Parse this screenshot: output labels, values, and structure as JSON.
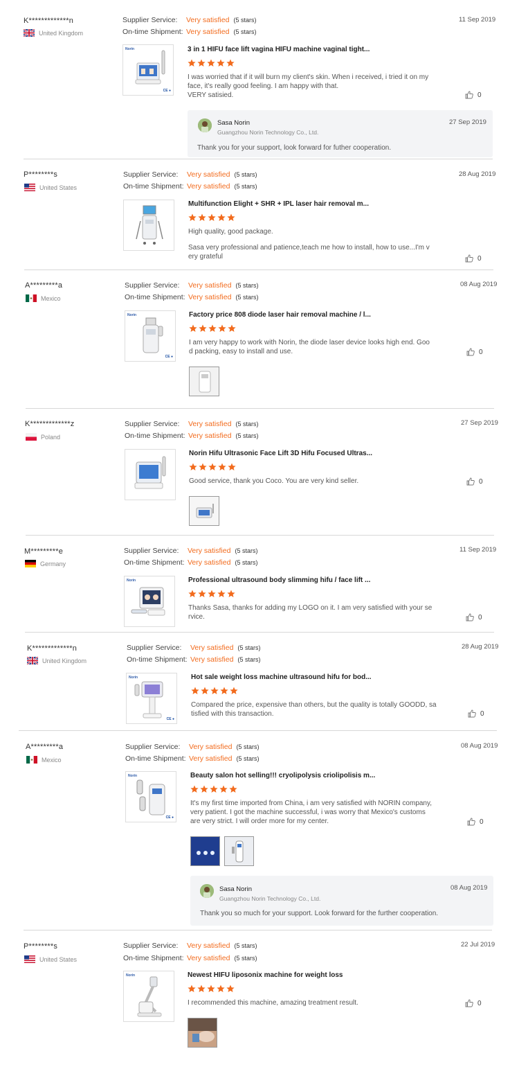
{
  "labels": {
    "supplier_service": "Supplier Service:",
    "ontime_shipment": "On-time Shipment:"
  },
  "accent_color": "#f26b1d",
  "reviews": [
    {
      "user": "K*************n",
      "country": "United Kingdom",
      "flag": "uk-flag-icon",
      "service_value": "Very satisfied",
      "service_stars": "(5 stars)",
      "shipment_value": "Very satisfied",
      "shipment_stars": "(5 stars)",
      "date": "11 Sep 2019",
      "product_title": "3 in 1 HIFU face lift vagina HIFU machine vaginal tight...",
      "rating": 5,
      "text_lines": [
        "I was worried that if it will burn my client's skin. When i received, i tried it on my",
        "face, it's really good feeling. I am happy with that.",
        "VERY satisied."
      ],
      "likes": "0",
      "reply": {
        "name": "Sasa Norin",
        "company": "Guangzhou Norin Technology Co., Ltd.",
        "date": "27 Sep 2019",
        "text": "Thank you for your support, look forward for futher cooperation."
      }
    },
    {
      "user": "P********s",
      "country": "United States",
      "flag": "us-flag-icon",
      "service_value": "Very satisfied",
      "service_stars": "(5 stars)",
      "shipment_value": "Very satisfied",
      "shipment_stars": "(5 stars)",
      "date": "28 Aug 2019",
      "product_title": "Multifunction Elight + SHR + IPL laser hair removal m...",
      "rating": 5,
      "text_lines": [
        "High quality, good package.",
        "",
        "Sasa very professional and patience,teach me how to install, how to use...I'm v",
        "ery grateful"
      ],
      "likes": "0"
    },
    {
      "user": "A*********a",
      "country": "Mexico",
      "flag": "mexico-flag-icon",
      "service_value": "Very satisfied",
      "service_stars": "(5 stars)",
      "shipment_value": "Very satisfied",
      "shipment_stars": "(5 stars)",
      "date": "08 Aug 2019",
      "product_title": "Factory price 808 diode laser hair removal machine / l...",
      "rating": 5,
      "text_lines": [
        "I am very happy to work with Norin, the diode laser device looks high end. Goo",
        "d packing, easy to install and use."
      ],
      "likes": "0"
    },
    {
      "user": "K*************z",
      "country": "Poland",
      "flag": "poland-flag-icon",
      "service_value": "Very satisfied",
      "service_stars": "(5 stars)",
      "shipment_value": "Very satisfied",
      "shipment_stars": "(5 stars)",
      "date": "27 Sep 2019",
      "product_title": "Norin Hifu Ultrasonic Face Lift 3D Hifu Focused Ultras...",
      "rating": 5,
      "text_lines": [
        "Good service, thank you Coco. You are very kind seller."
      ],
      "likes": "0"
    },
    {
      "user": "M*********e",
      "country": "Germany",
      "flag": "germany-flag-icon",
      "service_value": "Very satisfied",
      "service_stars": "(5 stars)",
      "shipment_value": "Very satisfied",
      "shipment_stars": "(5 stars)",
      "date": "11 Sep 2019",
      "product_title": "Professional ultrasound body slimming hifu / face lift ...",
      "rating": 5,
      "text_lines": [
        "Thanks Sasa, thanks for adding my LOGO on it. I am very satisfied with your se",
        "rvice."
      ],
      "likes": "0"
    },
    {
      "user": "K*************n",
      "country": "United Kingdom",
      "flag": "uk-flag-icon",
      "service_value": "Very satisfied",
      "service_stars": "(5 stars)",
      "shipment_value": "Very satisfied",
      "shipment_stars": "(5 stars)",
      "date": "28 Aug 2019",
      "product_title": "Hot sale weight loss machine ultrasound hifu for bod...",
      "rating": 5,
      "text_lines": [
        "Compared the price, expensive than others, but the quality is totally GOODD, sa",
        "tisfied with this transaction."
      ],
      "likes": "0"
    },
    {
      "user": "A*********a",
      "country": "Mexico",
      "flag": "mexico-flag-icon",
      "service_value": "Very satisfied",
      "service_stars": "(5 stars)",
      "shipment_value": "Very satisfied",
      "shipment_stars": "(5 stars)",
      "date": "08 Aug 2019",
      "product_title": "Beauty salon hot selling!!! cryolipolysis criolipolisis m...",
      "rating": 5,
      "text_lines": [
        "It's my first time imported from China, i am very satisfied with NORIN company,",
        "very patient. I got the machine successful, i was worry that Mexico's customs",
        "are very strict. I will order more for my center."
      ],
      "likes": "0",
      "reply": {
        "name": "Sasa Norin",
        "company": "Guangzhou Norin Technology Co., Ltd.",
        "date": "08 Aug 2019",
        "text": "Thank you so much for your support. Look forward for the further cooperation."
      }
    },
    {
      "user": "P********s",
      "country": "United States",
      "flag": "us-flag-icon",
      "service_value": "Very satisfied",
      "service_stars": "(5 stars)",
      "shipment_value": "Very satisfied",
      "shipment_stars": "(5 stars)",
      "date": "22 Jul 2019",
      "product_title": "Newest HIFU liposonix machine for weight loss",
      "rating": 5,
      "text_lines": [
        "I recommended this machine, amazing treatment result."
      ],
      "likes": "0"
    }
  ]
}
